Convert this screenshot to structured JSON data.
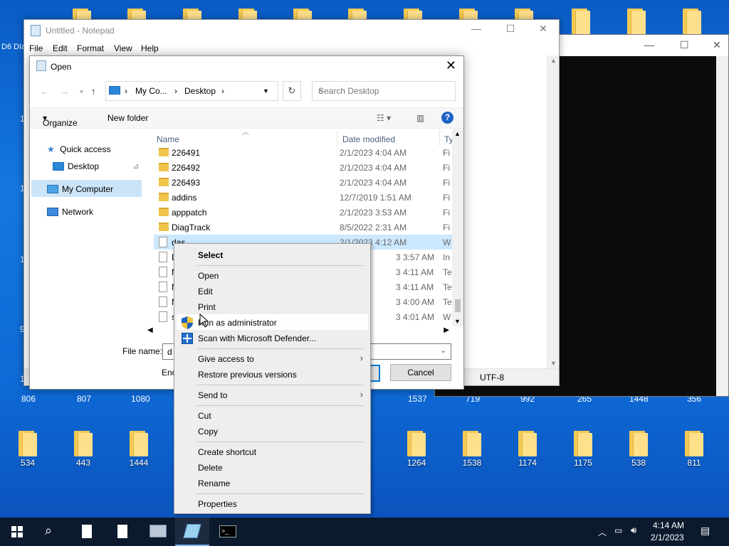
{
  "desktop": {
    "top_row_icons": [
      "",
      "",
      "",
      "",
      "",
      "",
      "",
      "",
      "",
      "",
      "",
      "",
      "",
      ""
    ],
    "mid_labels": [
      "806",
      "807",
      "1080",
      "1537",
      "719",
      "992",
      "265",
      "1448",
      "356"
    ],
    "bottom_row": [
      {
        "label": "534"
      },
      {
        "label": "443"
      },
      {
        "label": "1444"
      },
      {
        "label": "1264"
      },
      {
        "label": "1538"
      },
      {
        "label": "1174"
      },
      {
        "label": "1175"
      },
      {
        "label": "538"
      },
      {
        "label": "811"
      }
    ],
    "left_edge_text": [
      "1",
      "1",
      "1",
      "9",
      "1"
    ],
    "top_left_text": "D6  DIa"
  },
  "notepad": {
    "title": "Untitled - Notepad",
    "menu": [
      "File",
      "Edit",
      "Format",
      "View",
      "Help"
    ],
    "encoding": "UTF-8",
    "min_icon": "minimize-icon",
    "max_icon": "maximize-icon",
    "close_icon": "close-icon"
  },
  "dialog": {
    "title": "Open",
    "breadcrumb": [
      "My Co...",
      "Desktop"
    ],
    "search_placeholder": "Search Desktop",
    "organize": "Organize",
    "new_folder": "New folder",
    "nav": {
      "quick_access": "Quick access",
      "desktop": "Desktop",
      "my_computer": "My Computer",
      "network": "Network"
    },
    "columns": {
      "name": "Name",
      "date": "Date modified",
      "type": "Ty"
    },
    "files": [
      {
        "name": "226491",
        "date": "2/1/2023 4:04 AM",
        "type": "Fi",
        "kind": "folder"
      },
      {
        "name": "226492",
        "date": "2/1/2023 4:04 AM",
        "type": "Fi",
        "kind": "folder"
      },
      {
        "name": "226493",
        "date": "2/1/2023 4:04 AM",
        "type": "Fi",
        "kind": "folder"
      },
      {
        "name": "addins",
        "date": "12/7/2019 1:51 AM",
        "type": "Fi",
        "kind": "folder"
      },
      {
        "name": "apppatch",
        "date": "2/1/2023 3:53 AM",
        "type": "Fi",
        "kind": "folder"
      },
      {
        "name": "DiagTrack",
        "date": "8/5/2022 2:31 AM",
        "type": "Fi",
        "kind": "folder"
      },
      {
        "name": "das",
        "date": "2/1/2023 4:12 AM",
        "type": "W",
        "kind": "file"
      },
      {
        "name": "D",
        "date": "3 3:57 AM",
        "type": "In",
        "kind": "file"
      },
      {
        "name": "N",
        "date": "3 4:11 AM",
        "type": "Te",
        "kind": "file"
      },
      {
        "name": "N",
        "date": "3 4:11 AM",
        "type": "Te",
        "kind": "file"
      },
      {
        "name": "N",
        "date": "3 4:00 AM",
        "type": "Te",
        "kind": "file"
      },
      {
        "name": "s",
        "date": "3 4:01 AM",
        "type": "W",
        "kind": "file"
      }
    ],
    "file_name_label": "File name:",
    "file_name_value": "d",
    "encoding_label": "Enc",
    "open_button": "",
    "cancel_button": "Cancel"
  },
  "context_menu": {
    "select": "Select",
    "open": "Open",
    "edit": "Edit",
    "print": "Print",
    "run_as_admin": "Run as administrator",
    "scan": "Scan with Microsoft Defender...",
    "give_access": "Give access to",
    "restore": "Restore previous versions",
    "send_to": "Send to",
    "cut": "Cut",
    "copy": "Copy",
    "create_shortcut": "Create shortcut",
    "delete": "Delete",
    "rename": "Rename",
    "properties": "Properties"
  },
  "taskbar": {
    "time": "4:14 AM",
    "date": "2/1/2023"
  },
  "colors": {
    "desktop": "#1477e0",
    "taskbar": "#0c1a2e",
    "selection": "#cce8ff",
    "accent": "#0078d7"
  }
}
